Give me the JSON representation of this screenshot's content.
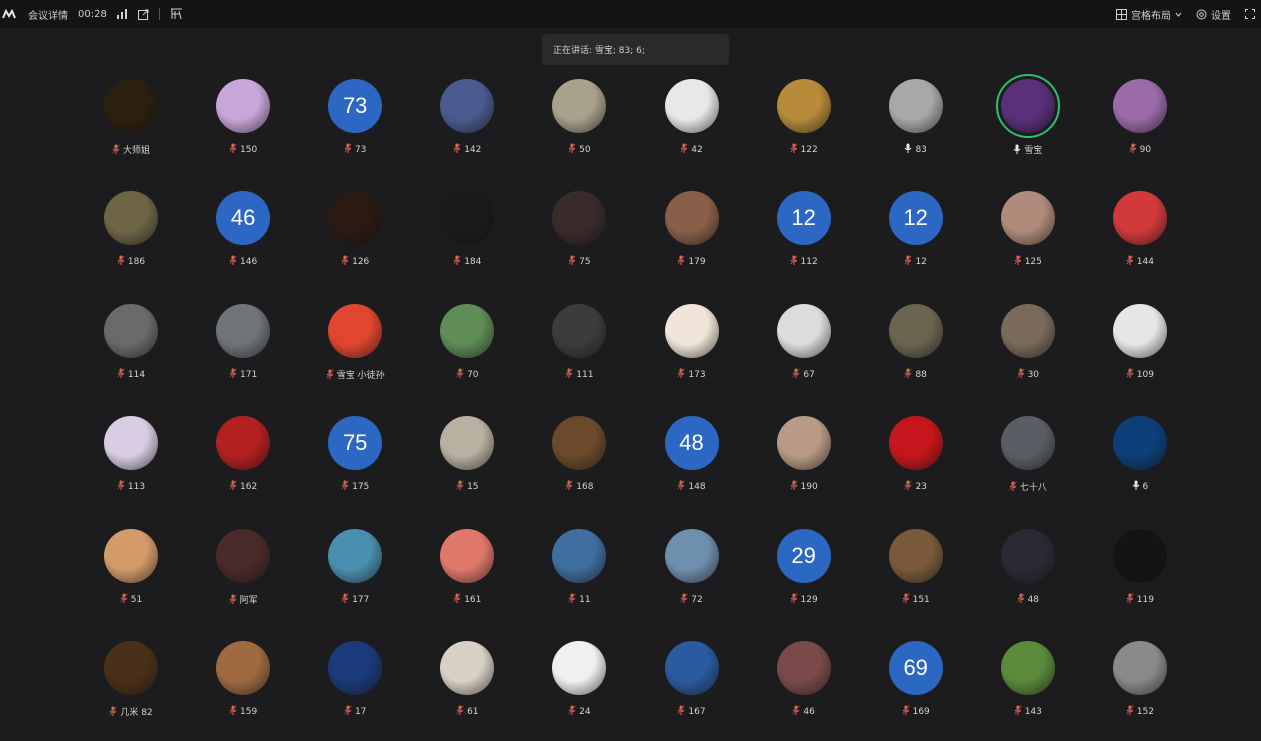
{
  "topbar": {
    "meeting_details": "会议详情",
    "duration": "00:28",
    "layout_label": "宫格布局",
    "settings_label": "设置"
  },
  "speaking": "正在讲话: 雪宝; 83; 6;",
  "participants": [
    {
      "label": "大师姐",
      "type": "photo",
      "color": "#2b1f10"
    },
    {
      "label": "150",
      "type": "photo",
      "color": "#c9a6d9"
    },
    {
      "label": "73",
      "type": "number",
      "number": "73"
    },
    {
      "label": "142",
      "type": "photo",
      "color": "#4a5c8f"
    },
    {
      "label": "50",
      "type": "photo",
      "color": "#a9a18c"
    },
    {
      "label": "42",
      "type": "photo",
      "color": "#e8e8e8"
    },
    {
      "label": "122",
      "type": "photo",
      "color": "#b78b3a"
    },
    {
      "label": "83",
      "type": "photo",
      "color": "#a8a8a8",
      "mic": "active"
    },
    {
      "label": "雪宝",
      "type": "photo",
      "color": "#5a2f7a",
      "active": true,
      "mic": "active"
    },
    {
      "label": "90",
      "type": "photo",
      "color": "#9b6aa8"
    },
    {
      "label": "186",
      "type": "photo",
      "color": "#6e6547"
    },
    {
      "label": "146",
      "type": "number",
      "number": "46"
    },
    {
      "label": "126",
      "type": "photo",
      "color": "#2a1a12"
    },
    {
      "label": "184",
      "type": "photo",
      "color": "#1a1a1a"
    },
    {
      "label": "75",
      "type": "photo",
      "color": "#3a2b2b"
    },
    {
      "label": "179",
      "type": "photo",
      "color": "#8a5f4a"
    },
    {
      "label": "112",
      "type": "number",
      "number": "12"
    },
    {
      "label": "12",
      "type": "number",
      "number": "12"
    },
    {
      "label": "125",
      "type": "photo",
      "color": "#b08a7a"
    },
    {
      "label": "144",
      "type": "photo",
      "color": "#d23a3a"
    },
    {
      "label": "114",
      "type": "photo",
      "color": "#6a6a6a"
    },
    {
      "label": "171",
      "type": "photo",
      "color": "#6f7478"
    },
    {
      "label": "雪宝 小徒孙",
      "type": "photo",
      "color": "#e0462f"
    },
    {
      "label": "70",
      "type": "photo",
      "color": "#5f8c57"
    },
    {
      "label": "111",
      "type": "photo",
      "color": "#3c3c3c"
    },
    {
      "label": "173",
      "type": "photo",
      "color": "#f0e5d8"
    },
    {
      "label": "67",
      "type": "photo",
      "color": "#dcdcdc"
    },
    {
      "label": "88",
      "type": "photo",
      "color": "#6b6550"
    },
    {
      "label": "30",
      "type": "photo",
      "color": "#7a6a5c"
    },
    {
      "label": "109",
      "type": "photo",
      "color": "#e6e6e6"
    },
    {
      "label": "113",
      "type": "photo",
      "color": "#d9cde4"
    },
    {
      "label": "162",
      "type": "photo",
      "color": "#b32020"
    },
    {
      "label": "175",
      "type": "number",
      "number": "75"
    },
    {
      "label": "15",
      "type": "photo",
      "color": "#b8b0a0"
    },
    {
      "label": "168",
      "type": "photo",
      "color": "#6a4a2a"
    },
    {
      "label": "148",
      "type": "number",
      "number": "48"
    },
    {
      "label": "190",
      "type": "photo",
      "color": "#b89a86"
    },
    {
      "label": "23",
      "type": "photo",
      "color": "#c4161c"
    },
    {
      "label": "七十八",
      "type": "photo",
      "color": "#5a5e64"
    },
    {
      "label": "6",
      "type": "photo",
      "color": "#0d3f7a",
      "mic": "active"
    },
    {
      "label": "51",
      "type": "photo",
      "color": "#d39a6a"
    },
    {
      "label": "阿军",
      "type": "photo",
      "color": "#4a2a2a"
    },
    {
      "label": "177",
      "type": "photo",
      "color": "#4b8fb0"
    },
    {
      "label": "161",
      "type": "photo",
      "color": "#e0786a"
    },
    {
      "label": "11",
      "type": "photo",
      "color": "#3f6f9f"
    },
    {
      "label": "72",
      "type": "photo",
      "color": "#6f8fae"
    },
    {
      "label": "129",
      "type": "number",
      "number": "29"
    },
    {
      "label": "151",
      "type": "photo",
      "color": "#7a5a3a"
    },
    {
      "label": "48",
      "type": "photo",
      "color": "#2a2a34"
    },
    {
      "label": "119",
      "type": "photo",
      "color": "#141414"
    },
    {
      "label": "几米 82",
      "type": "photo",
      "color": "#4a3018"
    },
    {
      "label": "159",
      "type": "photo",
      "color": "#a06a40"
    },
    {
      "label": "17",
      "type": "photo",
      "color": "#1a3a7a"
    },
    {
      "label": "61",
      "type": "photo",
      "color": "#d8d0c4"
    },
    {
      "label": "24",
      "type": "photo",
      "color": "#f0f0f0"
    },
    {
      "label": "167",
      "type": "photo",
      "color": "#2a5aa0"
    },
    {
      "label": "46",
      "type": "photo",
      "color": "#7a4a4a"
    },
    {
      "label": "169",
      "type": "number",
      "number": "69"
    },
    {
      "label": "143",
      "type": "photo",
      "color": "#5a8a3a"
    },
    {
      "label": "152",
      "type": "photo",
      "color": "#8a8a8a"
    }
  ],
  "colors": {
    "number_avatar_bg": "#2c67c4",
    "active_speaker_ring": "#2fbf6d",
    "muted_mic": "#e06a5a"
  }
}
